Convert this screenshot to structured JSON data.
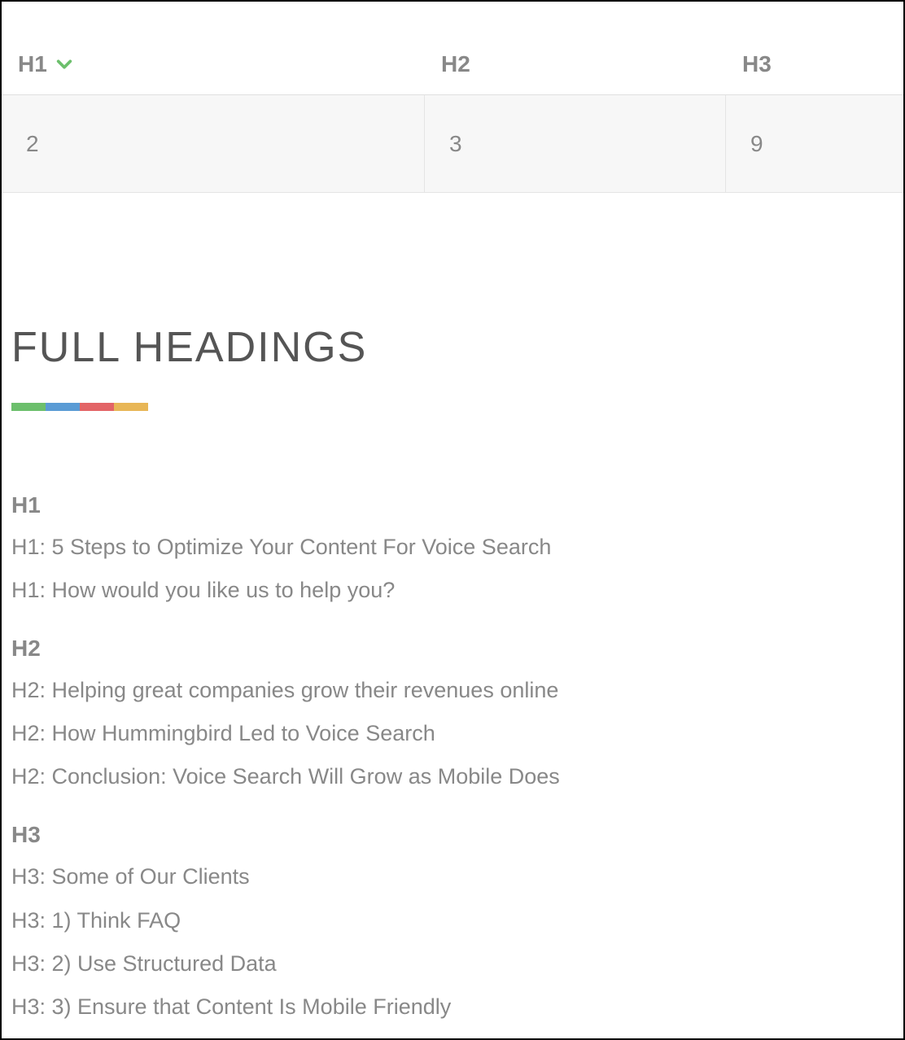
{
  "tabs": [
    {
      "label": "H1",
      "active": true,
      "count": "2"
    },
    {
      "label": "H2",
      "active": false,
      "count": "3"
    },
    {
      "label": "H3",
      "active": false,
      "count": "9"
    }
  ],
  "section_title": "FULL HEADINGS",
  "color_bar": [
    "#6cbf6c",
    "#5a9bd5",
    "#e36466",
    "#e8b656"
  ],
  "groups": [
    {
      "label": "H1",
      "items": [
        "H1: 5 Steps to Optimize Your Content For Voice Search",
        "H1: How would you like us to help you?"
      ]
    },
    {
      "label": "H2",
      "items": [
        "H2: Helping great companies grow their revenues online",
        "H2: How Hummingbird Led to Voice Search",
        "H2: Conclusion: Voice Search Will Grow as Mobile Does"
      ]
    },
    {
      "label": "H3",
      "items": [
        "H3: Some of Our Clients",
        "H3: 1) Think FAQ",
        "H3: 2) Use Structured Data",
        "H3: 3) Ensure that Content Is Mobile Friendly"
      ]
    }
  ]
}
